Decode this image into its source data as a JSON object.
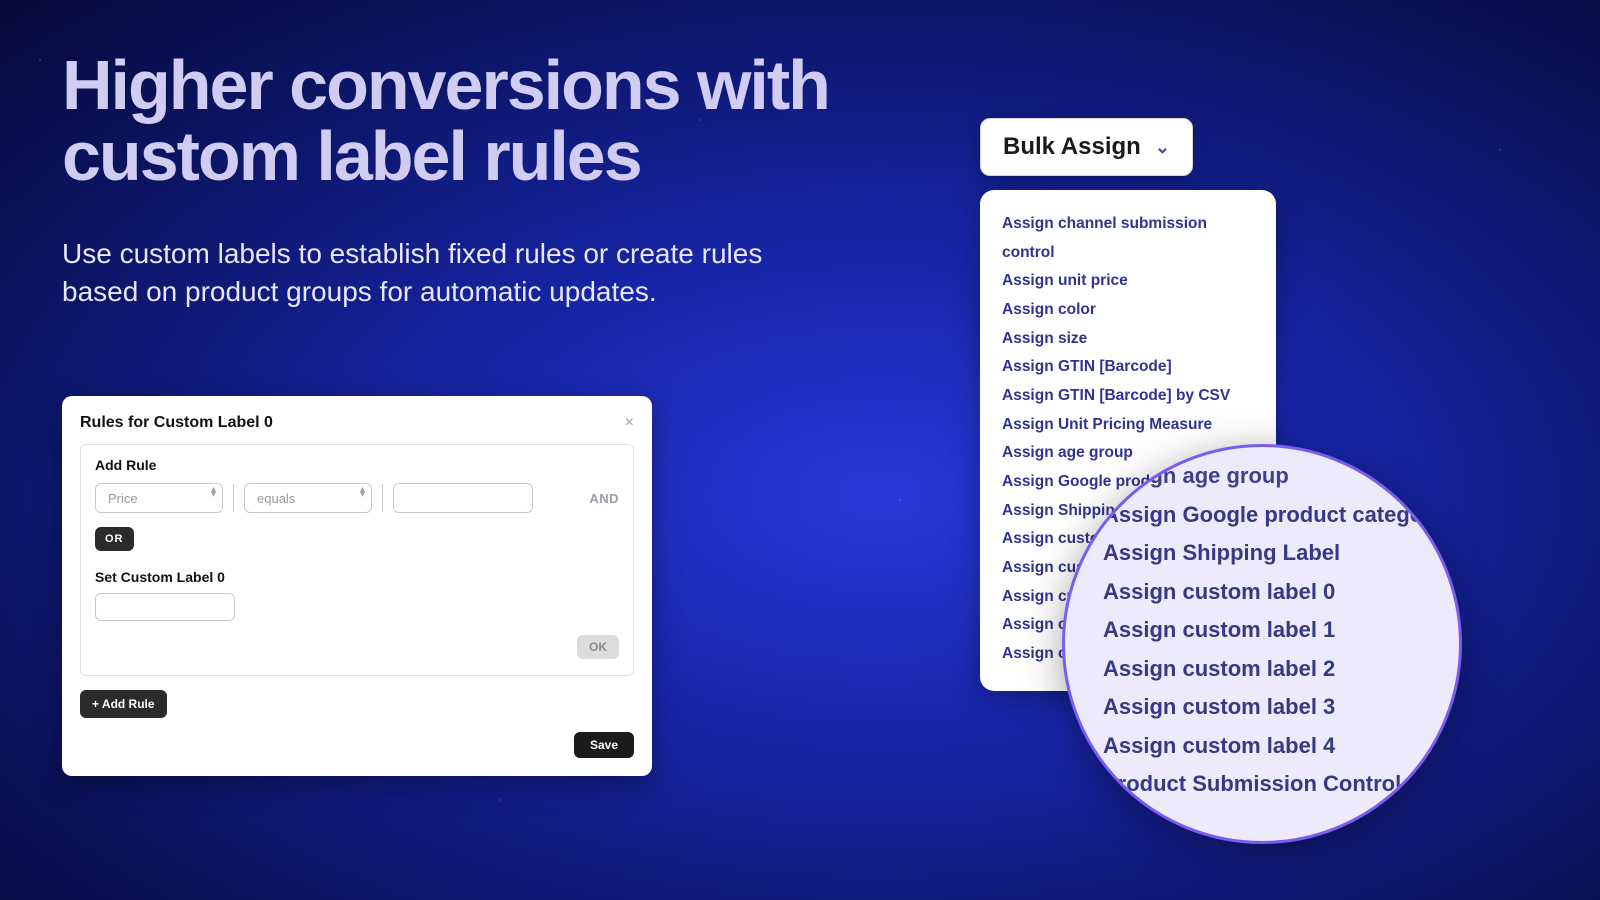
{
  "headline": "Higher conversions with custom label rules",
  "subhead": "Use custom labels to establish fixed rules or create rules based on product groups for automatic updates.",
  "panel": {
    "title": "Rules for Custom Label 0",
    "close": "×",
    "addrule_heading": "Add Rule",
    "field_value": "Price",
    "operator_value": "equals",
    "and_label": "AND",
    "or_label": "OR",
    "set_label": "Set Custom Label 0",
    "ok": "OK",
    "add_rule_btn": "+ Add Rule",
    "save": "Save"
  },
  "bulk": {
    "label": "Bulk Assign",
    "items": [
      "Assign channel submission control",
      "Assign unit price",
      "Assign color",
      "Assign size",
      "Assign GTIN [Barcode]",
      "Assign GTIN [Barcode] by CSV",
      "Assign Unit Pricing Measure",
      "Assign age group",
      "Assign Google product category",
      "Assign Shipping Label",
      "Assign custom label 0",
      "Assign custom label 1",
      "Assign custom label 2",
      "Assign custom label 3",
      "Assign custom label 4"
    ]
  },
  "lens": {
    "items": [
      "Assign age group",
      "Assign Google product category",
      "Assign Shipping Label",
      "Assign custom label 0",
      "Assign custom label 1",
      "Assign custom label 2",
      "Assign custom label 3",
      "Assign custom label 4",
      "Product Submission Control"
    ]
  }
}
